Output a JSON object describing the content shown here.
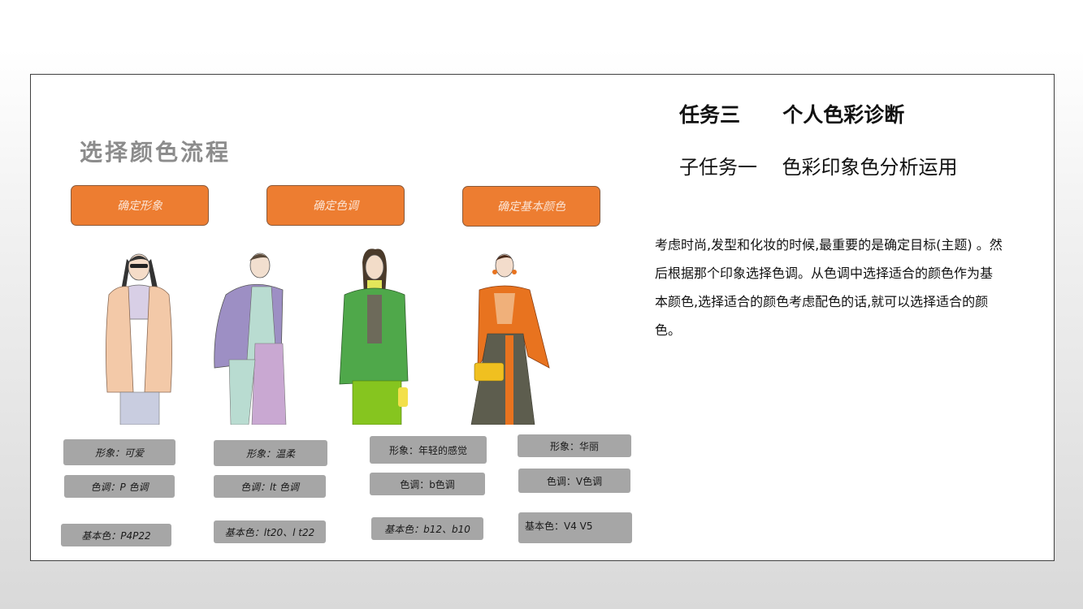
{
  "process_title": "选择颜色流程",
  "task_title": "任务三      个人色彩诊断",
  "subtask_title": "子任务一    色彩印象色分析运用",
  "description": "考虑时尚,发型和化妆的时候,最重要的是确定目标(主题) 。然后根据那个印象选择色调。从色调中选择适合的颜色作为基本颜色,选择适合的颜色考虑配色的话,就可以选择适合的颜色。",
  "steps": [
    "确定形象",
    "确定色调",
    "确定基本颜色"
  ],
  "colors": {
    "step_fill": "#ed7d31",
    "tag_fill": "#a6a6a6",
    "title_gray": "#8c8c8c"
  },
  "figures": [
    {
      "name": "figure-cute",
      "top": "#f3c9a8",
      "accent": "#d8cfe6",
      "bottom": "#c9cde0"
    },
    {
      "name": "figure-gentle",
      "top": "#9d8fc4",
      "accent": "#b9dcd1",
      "bottom": "#c9a8d2"
    },
    {
      "name": "figure-youthful",
      "top": "#4fa84a",
      "accent": "#e3e65a",
      "bottom": "#86c51f"
    },
    {
      "name": "figure-gorgeous",
      "top": "#e8731f",
      "accent": "#f0c020",
      "bottom": "#5d5d4e"
    }
  ],
  "columns": [
    {
      "image": "形象：可爱",
      "tone": "色调：P 色调",
      "base": "基本色：P4P22"
    },
    {
      "image": "形象：温柔",
      "tone": "色调：lt 色调",
      "base": "基本色：lt20、l t22"
    },
    {
      "image": "形象：年轻的感觉",
      "tone": "色调：b色调",
      "base": "基本色：b12、b10"
    },
    {
      "image": "形象：华丽",
      "tone": "色调：V色调",
      "base": "基本色：V4 V5"
    }
  ]
}
